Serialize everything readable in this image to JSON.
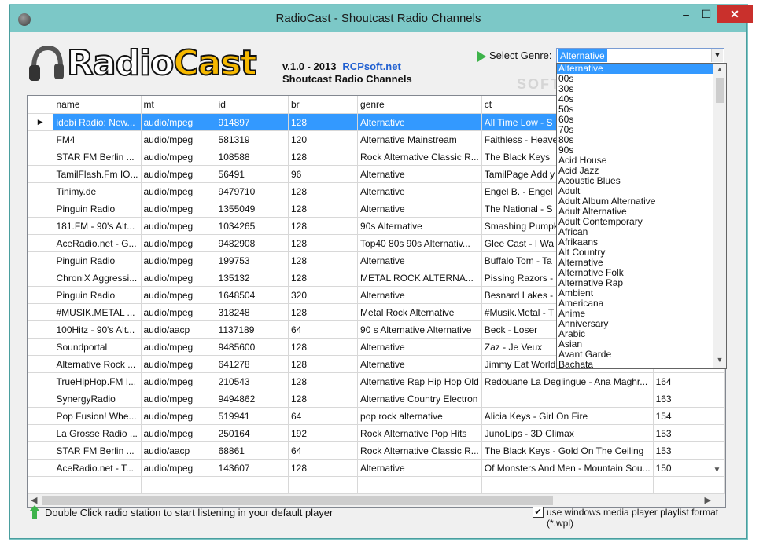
{
  "window": {
    "title": "RadioCast - Shoutcast Radio Channels",
    "minimize": "–",
    "maximize": "☐",
    "close": "✕"
  },
  "header": {
    "logo_part1": "Radio",
    "logo_part2": "Cast",
    "version": "v.1.0 - 2013",
    "link": "RCPsoft.net",
    "subtitle": "Shoutcast Radio Channels",
    "genre_label": "Select Genre:",
    "genre_selected": "Alternative",
    "watermark": "SOFTPEDIA"
  },
  "genres": [
    "Alternative",
    "00s",
    "30s",
    "40s",
    "50s",
    "60s",
    "70s",
    "80s",
    "90s",
    "Acid House",
    "Acid Jazz",
    "Acoustic Blues",
    "Adult",
    "Adult Album Alternative",
    "Adult Alternative",
    "Adult Contemporary",
    "African",
    "Afrikaans",
    "Alt Country",
    "Alternative",
    "Alternative Folk",
    "Alternative Rap",
    "Ambient",
    "Americana",
    "Anime",
    "Anniversary",
    "Arabic",
    "Asian",
    "Avant Garde",
    "Bachata"
  ],
  "table": {
    "columns": [
      "name",
      "mt",
      "id",
      "br",
      "genre",
      "ct",
      ""
    ],
    "rows": [
      [
        "idobi Radio: New...",
        "audio/mpeg",
        "914897",
        "128",
        "Alternative",
        "All Time Low - S",
        ""
      ],
      [
        "FM4",
        "audio/mpeg",
        "581319",
        "120",
        "Alternative Mainstream",
        "Faithless - Heave",
        ""
      ],
      [
        "STAR FM Berlin ...",
        "audio/mpeg",
        "108588",
        "128",
        "Rock  Alternative  Classic R...",
        "The Black Keys",
        ""
      ],
      [
        "TamilFlash.Fm IO...",
        "audio/mpeg",
        "56491",
        "96",
        "Alternative",
        "TamilPage Add y",
        ""
      ],
      [
        "Tinimy.de",
        "audio/mpeg",
        "9479710",
        "128",
        "Alternative",
        "Engel B. - Engel",
        ""
      ],
      [
        "Pinguin Radio",
        "audio/mpeg",
        "1355049",
        "128",
        "Alternative",
        "The National - S",
        ""
      ],
      [
        "181.FM - 90's Alt...",
        "audio/mpeg",
        "1034265",
        "128",
        "90s Alternative",
        "Smashing Pumpk",
        ""
      ],
      [
        "AceRadio.net - G...",
        "audio/mpeg",
        "9482908",
        "128",
        "Top40  80s  90s  Alternativ...",
        "Glee Cast - I Wa",
        ""
      ],
      [
        "Pinguin Radio",
        "audio/mpeg",
        "199753",
        "128",
        "Alternative",
        "Buffalo Tom - Ta",
        ""
      ],
      [
        "ChroniX Aggressi...",
        "audio/mpeg",
        "135132",
        "128",
        "METAL  ROCK  ALTERNA...",
        "Pissing Razors -",
        ""
      ],
      [
        "Pinguin Radio",
        "audio/mpeg",
        "1648504",
        "320",
        "Alternative",
        "Besnard Lakes -",
        ""
      ],
      [
        "#MUSIK.METAL ...",
        "audio/mpeg",
        "318248",
        "128",
        "Metal Rock Alternative",
        "#Musik.Metal - T",
        ""
      ],
      [
        "100Hitz - 90's Alt...",
        "audio/aacp",
        "1137189",
        "64",
        "90 s Alternative  Alternative",
        "Beck - Loser",
        ""
      ],
      [
        "Soundportal",
        "audio/mpeg",
        "9485600",
        "128",
        "Alternative",
        "Zaz - Je Veux",
        ""
      ],
      [
        "Alternative Rock ...",
        "audio/mpeg",
        "641278",
        "128",
        "Alternative",
        "Jimmy Eat World",
        ""
      ],
      [
        "TrueHipHop.FM I...",
        "audio/mpeg",
        "210543",
        "128",
        "Alternative Rap  Hip Hop  Old",
        "Redouane La Deglingue - Ana Maghr...",
        "164"
      ],
      [
        "SynergyRadio",
        "audio/mpeg",
        "9494862",
        "128",
        "Alternative  Country  Electron",
        "",
        "163"
      ],
      [
        "Pop Fusion! Whe...",
        "audio/mpeg",
        "519941",
        "64",
        "pop rock alternative",
        "Alicia Keys - Girl On Fire",
        "154"
      ],
      [
        "La Grosse Radio ...",
        "audio/mpeg",
        "250164",
        "192",
        "Rock Alternative Pop Hits",
        "JunoLips - 3D Climax",
        "153"
      ],
      [
        "STAR FM Berlin ...",
        "audio/aacp",
        "68861",
        "64",
        "Rock  Alternative  Classic R...",
        "The Black Keys - Gold On The Ceiling",
        "153"
      ],
      [
        "AceRadio.net - T...",
        "audio/mpeg",
        "143607",
        "128",
        "Alternative",
        "Of Monsters And Men - Mountain Sou...",
        "150"
      ],
      [
        "",
        "",
        "",
        "",
        "",
        "",
        ""
      ]
    ]
  },
  "footer": {
    "hint": "Double Click radio station to start listening in your default player",
    "checkbox_label": "use windows media player playlist format (*.wpl)",
    "checkbox_mark": "✔"
  }
}
